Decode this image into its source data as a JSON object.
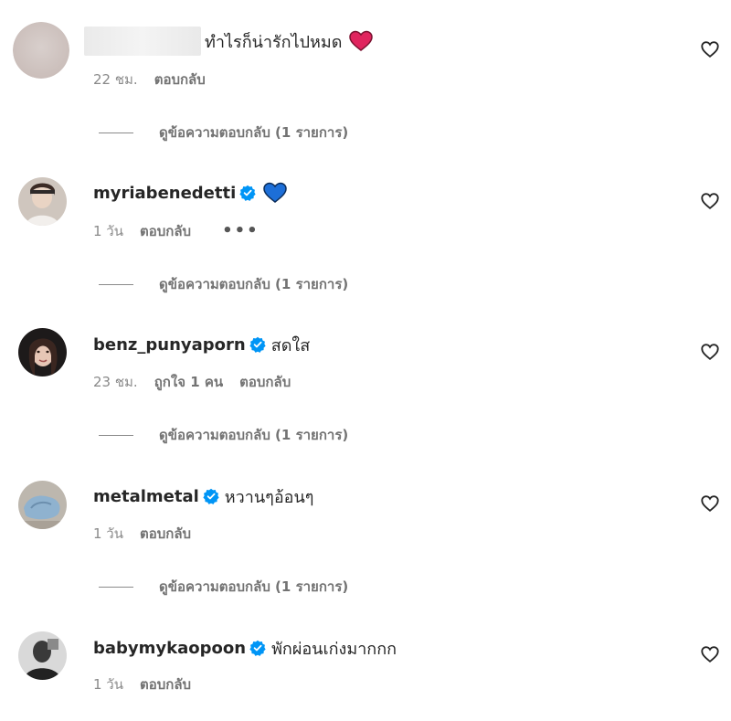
{
  "comments": [
    {
      "username": "",
      "username_redacted": true,
      "text": "ทำไรก็น่ารักไปหมด",
      "emoji": "red-heart-emoji",
      "time": "22 ชม.",
      "likes": "",
      "reply_label": "ตอบกลับ",
      "view_replies": "ดูข้อความตอบกลับ (1 รายการ)",
      "verified": false,
      "avatar": "blurred-avatar"
    },
    {
      "username": "myriabenedetti",
      "text": "",
      "emoji": "blue-heart-emoji",
      "time": "1 วัน",
      "likes": "",
      "reply_label": "ตอบกลับ",
      "view_replies": "ดูข้อความตอบกลับ (1 รายการ)",
      "verified": true,
      "show_more": true,
      "avatar": "profile-photo"
    },
    {
      "username": "benz_punyaporn",
      "text": "สดใส",
      "emoji": "",
      "time": "23 ชม.",
      "likes": "ถูกใจ 1 คน",
      "reply_label": "ตอบกลับ",
      "view_replies": "ดูข้อความตอบกลับ (1 รายการ)",
      "verified": true,
      "avatar": "profile-photo"
    },
    {
      "username": "metalmetal",
      "text": "หวานๆอ้อนๆ",
      "emoji": "",
      "time": "1 วัน",
      "likes": "",
      "reply_label": "ตอบกลับ",
      "view_replies": "ดูข้อความตอบกลับ (1 รายการ)",
      "verified": true,
      "avatar": "profile-photo"
    },
    {
      "username": "babymykaopoon",
      "text": "พักผ่อนเก่งมากกก",
      "emoji": "",
      "time": "1 วัน",
      "likes": "",
      "reply_label": "ตอบกลับ",
      "view_replies": "",
      "verified": true,
      "avatar": "profile-photo"
    }
  ],
  "colors": {
    "verified": "#0095f6",
    "secondary_text": "#737373",
    "primary_text": "#262626",
    "red_heart": "#e0245e",
    "blue_heart": "#1d6fd8"
  }
}
